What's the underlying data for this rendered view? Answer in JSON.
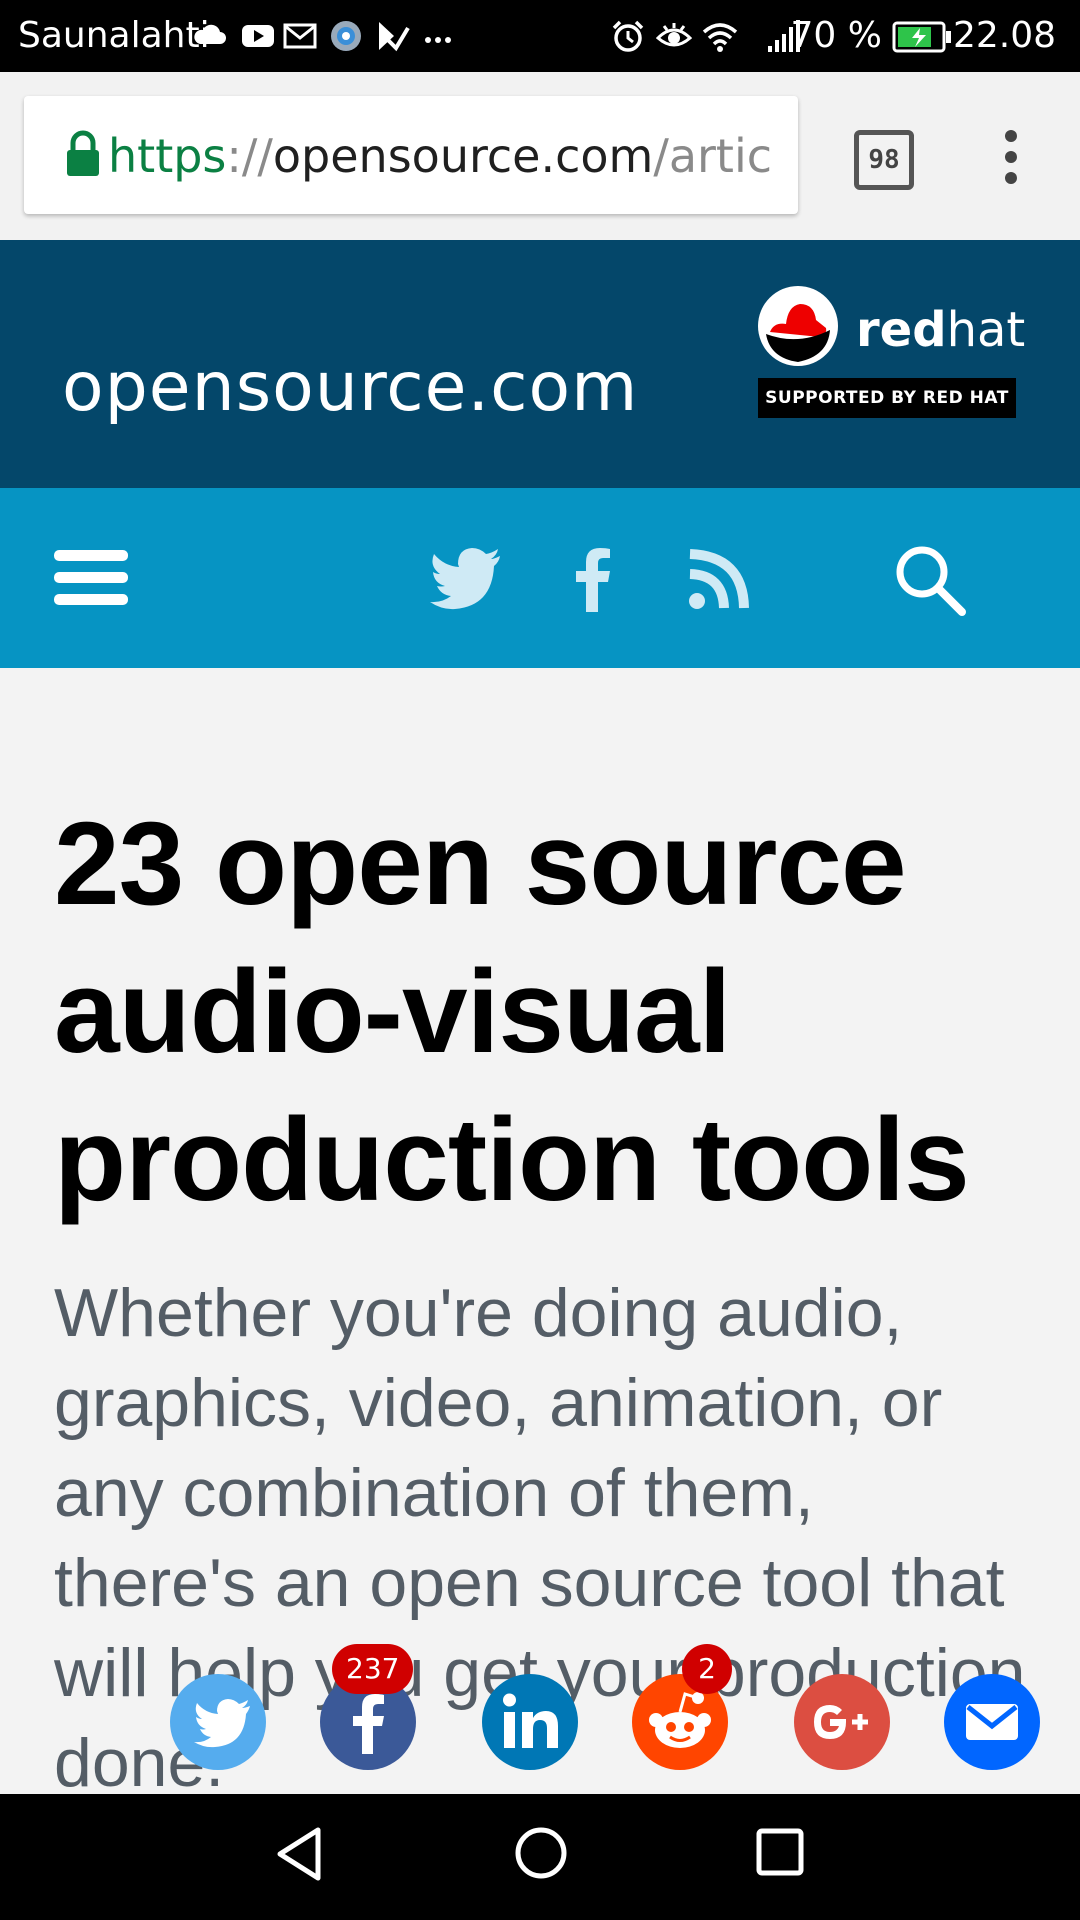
{
  "status_bar": {
    "carrier": "Saunalahti",
    "battery": "70 %",
    "time": "22.08",
    "icons": [
      "cloud-icon",
      "youtube-icon",
      "gmail-icon",
      "app-icon",
      "check-icon",
      "more-icon",
      "alarm-icon",
      "eye-icon",
      "wifi-icon",
      "signal-icon",
      "battery-icon"
    ]
  },
  "browser": {
    "url_scheme": "https",
    "url_sep": "://",
    "url_host": "opensource.com",
    "url_path": "/articl",
    "tab_count": "98",
    "icons": [
      "lock-icon",
      "tabs-icon",
      "overflow-menu-icon"
    ]
  },
  "site_header": {
    "logo": "opensource.com",
    "redhat_bold": "red",
    "redhat_light": "hat",
    "redhat_badge": "SUPPORTED BY RED HAT"
  },
  "nav": {
    "icons": [
      "menu-icon",
      "twitter-icon",
      "facebook-icon",
      "rss-icon",
      "search-icon"
    ]
  },
  "article": {
    "title": "23 open source audio-visual production tools",
    "lead": "Whether you're doing audio, graphics, video, animation, or any combination of them, there's an open source tool that will help you get your production done."
  },
  "share_bar": {
    "facebook_count": "237",
    "reddit_count": "2",
    "colors": {
      "twitter": "#55acee",
      "facebook": "#3b5998",
      "linkedin": "#0077b5",
      "reddit": "#ff4500",
      "googleplus": "#dc4e41",
      "email": "#0166ff"
    }
  },
  "system_nav": {
    "icons": [
      "back-icon",
      "home-icon",
      "recents-icon"
    ]
  }
}
